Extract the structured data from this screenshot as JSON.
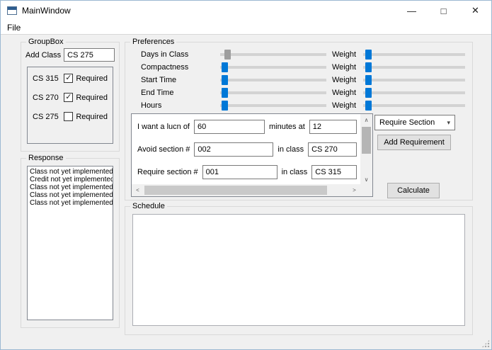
{
  "window": {
    "title": "MainWindow",
    "minimize_glyph": "—",
    "maximize_glyph": "□",
    "close_glyph": "✕"
  },
  "menu": {
    "file_label": "File"
  },
  "colors": {
    "accent": "#0078d7",
    "window_bg": "#f0f0f0"
  },
  "groupbox": {
    "title": "GroupBox",
    "add_class_label": "Add Class",
    "add_class_value": "CS 275",
    "classes": [
      {
        "name": "CS 315",
        "required_label": "Required",
        "checked": true,
        "check_glyph": "✓"
      },
      {
        "name": "CS 270",
        "required_label": "Required",
        "checked": true,
        "check_glyph": "✓"
      },
      {
        "name": "CS 275",
        "required_label": "Required",
        "checked": false,
        "check_glyph": ""
      }
    ]
  },
  "response": {
    "title": "Response",
    "messages": [
      "Class not yet implemented",
      "Credit not yet implemented",
      "Class not yet implemented",
      "Class not yet implemented",
      "Class not yet implemented"
    ]
  },
  "preferences": {
    "title": "Preferences",
    "weight_label": "Weight",
    "sliders": [
      {
        "label": "Days in Class"
      },
      {
        "label": "Compactness"
      },
      {
        "label": "Start Time"
      },
      {
        "label": "End Time"
      },
      {
        "label": "Hours"
      }
    ],
    "requirements": [
      {
        "text_before": "I want a lucn of",
        "value1": "60",
        "text_middle": "minutes at",
        "value2": "12"
      },
      {
        "text_before": "Avoid section #",
        "value1": "002",
        "text_middle": "in class",
        "value2": "CS 270"
      },
      {
        "text_before": "Require section #",
        "value1": "001",
        "text_middle": "in class",
        "value2": "CS 315"
      }
    ],
    "requirement_type_dropdown": {
      "value": "Require Section",
      "arrow_glyph": "▾"
    },
    "add_requirement_label": "Add Requirement",
    "calculate_label": "Calculate",
    "scrollbar": {
      "up_glyph": "∧",
      "down_glyph": "∨",
      "left_glyph": "<",
      "right_glyph": ">"
    }
  },
  "schedule": {
    "title": "Schedule"
  }
}
